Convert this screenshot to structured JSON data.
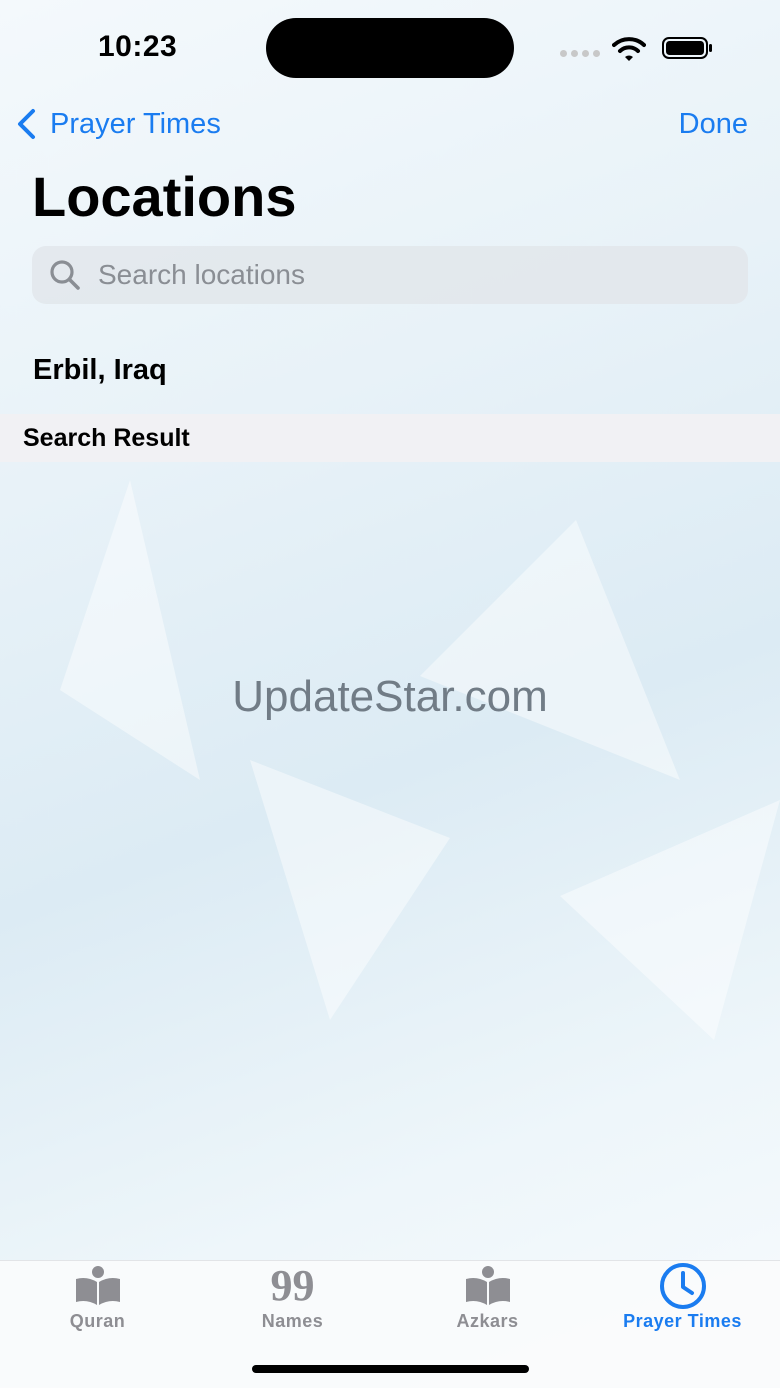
{
  "status_bar": {
    "time": "10:23"
  },
  "nav": {
    "back_label": "Prayer Times",
    "done_label": "Done"
  },
  "page": {
    "title": "Locations"
  },
  "search": {
    "placeholder": "Search locations",
    "value": ""
  },
  "locations": [
    {
      "label": "Erbil, Iraq"
    }
  ],
  "section": {
    "title": "Search Result"
  },
  "watermark": "UpdateStar.com",
  "tabs": [
    {
      "label": "Quran",
      "icon": "book-icon",
      "active": false
    },
    {
      "label": "Names",
      "icon": "ninety-nine-icon",
      "glyph": "99",
      "active": false
    },
    {
      "label": "Azkars",
      "icon": "book-icon",
      "active": false
    },
    {
      "label": "Prayer Times",
      "icon": "clock-icon",
      "active": true
    }
  ],
  "colors": {
    "accent": "#1a7cf0",
    "inactive": "#8e8e93"
  }
}
